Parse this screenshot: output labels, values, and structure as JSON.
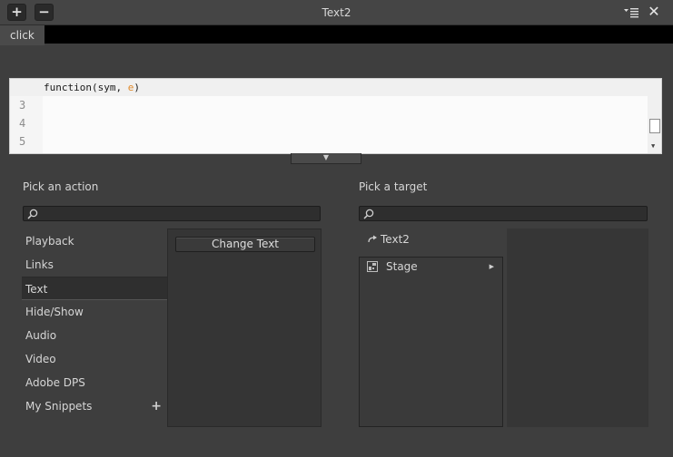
{
  "window": {
    "title": "Text2",
    "add_label": "+",
    "remove_label": "−",
    "close_label": "✕"
  },
  "event": {
    "tab_label": "click"
  },
  "editor": {
    "signature": "function(sym, ",
    "param": "e",
    "closing": ")",
    "line_numbers": [
      "3",
      "4",
      "5"
    ]
  },
  "actions": {
    "title": "Pick an action",
    "search_placeholder": "",
    "items": [
      {
        "label": "Playback"
      },
      {
        "label": "Links"
      },
      {
        "label": "Text"
      },
      {
        "label": "Hide/Show"
      },
      {
        "label": "Audio"
      },
      {
        "label": "Video"
      },
      {
        "label": "Adobe DPS"
      },
      {
        "label": "My Snippets"
      }
    ],
    "selected": "Text",
    "add_snippet_label": "+",
    "commands": [
      {
        "label": "Change Text"
      }
    ]
  },
  "targets": {
    "title": "Pick a target",
    "search_placeholder": "",
    "root_label": "Text2",
    "tree": [
      {
        "label": "Stage"
      }
    ]
  }
}
